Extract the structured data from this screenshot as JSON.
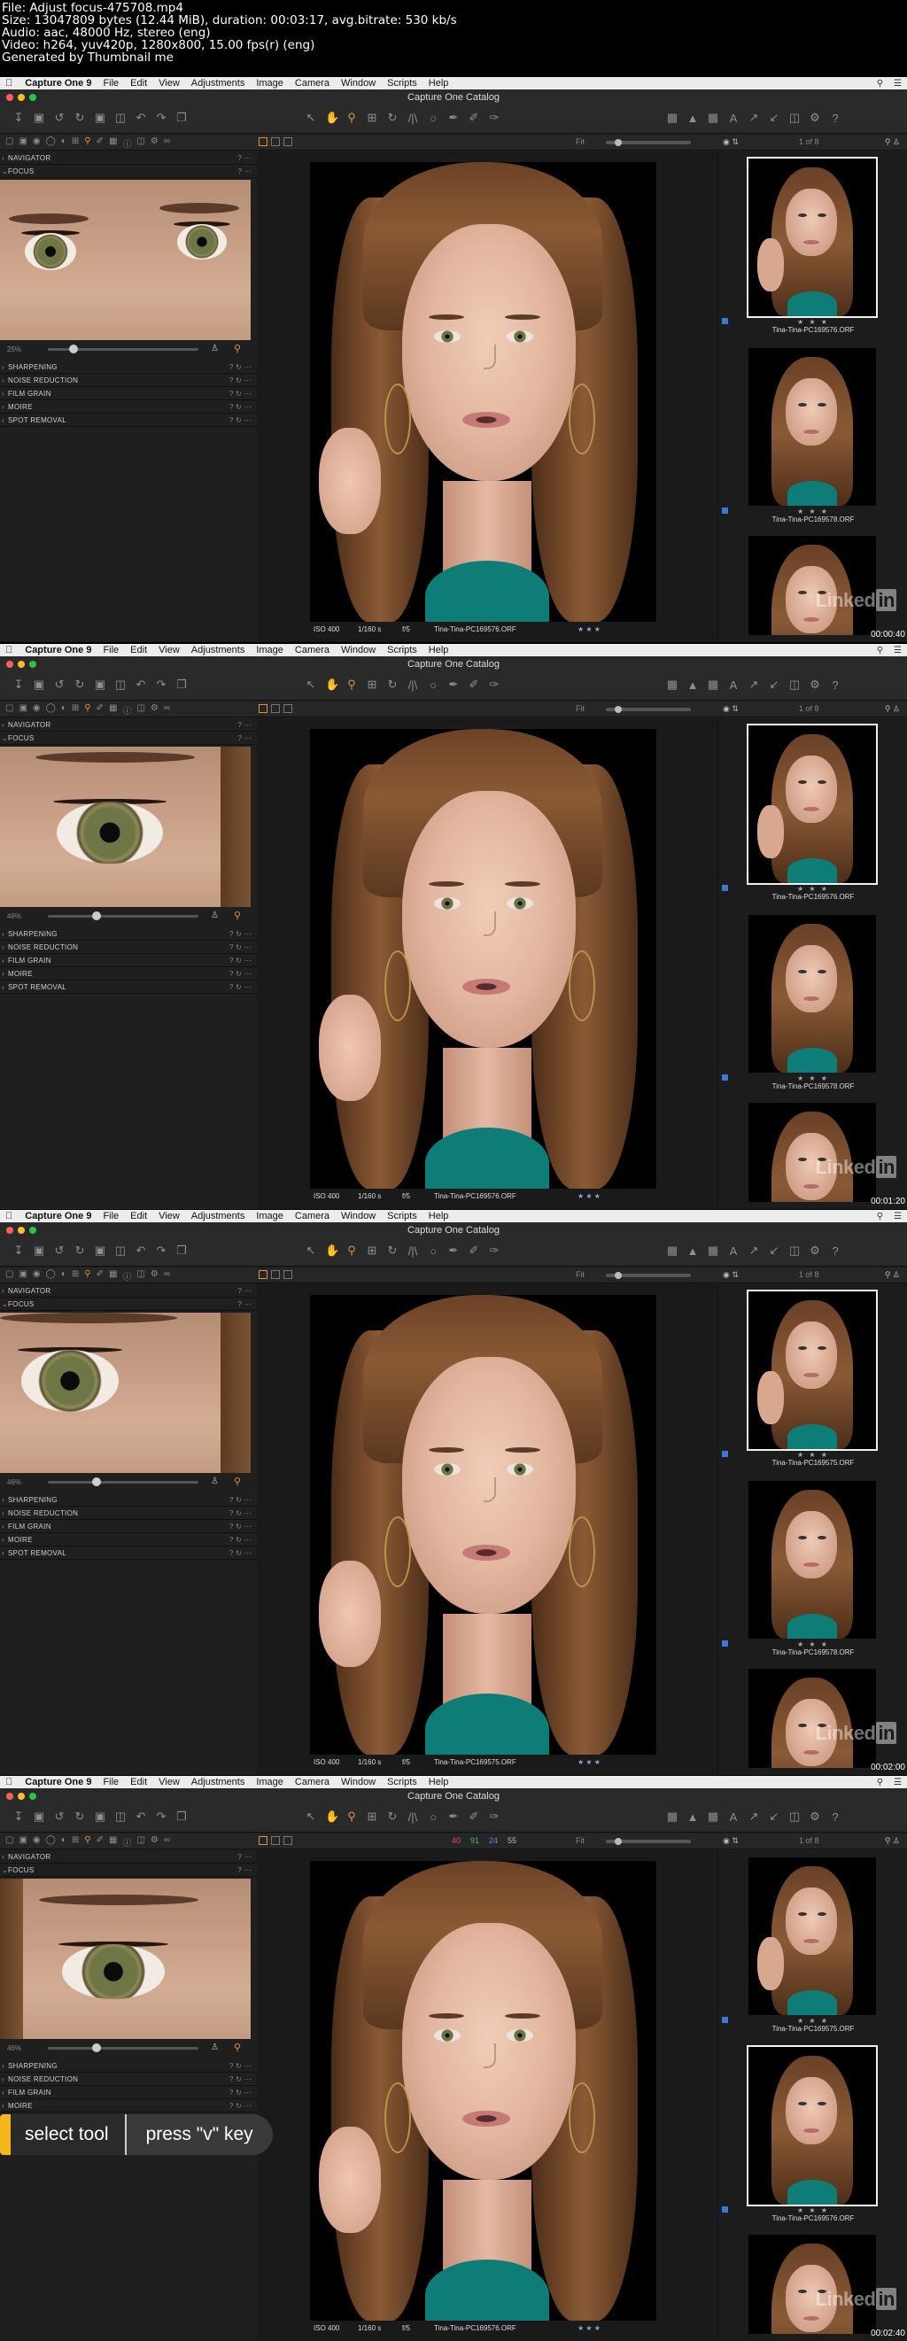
{
  "file_info": [
    "File: Adjust focus-475708.mp4",
    "Size: 13047809 bytes (12.44 MiB), duration: 00:03:17, avg.bitrate: 530 kb/s",
    "Audio: aac, 48000 Hz, stereo (eng)",
    "Video: h264, yuv420p, 1280x800, 15.00 fps(r) (eng)",
    "Generated by Thumbnail me"
  ],
  "menu": {
    "apple": "",
    "app": "Capture One 9",
    "items": [
      "File",
      "Edit",
      "View",
      "Adjustments",
      "Image",
      "Camera",
      "Window",
      "Scripts",
      "Help"
    ]
  },
  "window_title": "Capture One Catalog",
  "panels": {
    "navigator": "NAVIGATOR",
    "focus": "FOCUS",
    "sections": [
      "SHARPENING",
      "NOISE REDUCTION",
      "FILM GRAIN",
      "MOIRE",
      "SPOT REMOVAL"
    ]
  },
  "viewer": {
    "fit": "Fit",
    "iso": "ISO 400",
    "shutter": "1/160 s",
    "aperture": "f/5",
    "stars": "★ ★ ★"
  },
  "frames": [
    {
      "focus_zoom": "25%",
      "count": "1 of 8",
      "filename": "Tina-Tina-PC169576.ORF",
      "thumbs": [
        "Tina-Tina-PC169576.ORF",
        "Tina-Tina-PC169578.ORF"
      ],
      "timestamp": "00:00:40"
    },
    {
      "focus_zoom": "46%",
      "count": "1 of 8",
      "filename": "Tina-Tina-PC169576.ORF",
      "thumbs": [
        "Tina-Tina-PC169576.ORF",
        "Tina-Tina-PC169578.ORF"
      ],
      "timestamp": "00:01:20"
    },
    {
      "focus_zoom": "46%",
      "count": "1 of 8",
      "filename": "Tina-Tina-PC169575.ORF",
      "thumbs": [
        "Tina-Tina-PC169575.ORF",
        "Tina-Tina-PC169578.ORF"
      ],
      "timestamp": "00:02:00"
    },
    {
      "focus_zoom": "46%",
      "count": "1 of 8",
      "filename": "Tina-Tina-PC169576.ORF",
      "thumbs": [
        "Tina-Tina-PC169575.ORF",
        "Tina-Tina-PC169576.ORF"
      ],
      "timestamp": "00:02:40",
      "color_values": [
        {
          "value": "40",
          "color": "#e05050"
        },
        {
          "value": "91",
          "color": "#4fbf4f"
        },
        {
          "value": "24",
          "color": "#4f8fe0"
        },
        {
          "value": "55",
          "color": "#bbbbbb"
        }
      ]
    }
  ],
  "watermark": {
    "text": "Linked",
    "badge": "in"
  },
  "caption": {
    "left": "select tool",
    "right": "press \"v\" key"
  },
  "colors": {
    "accent": "#e3923d",
    "shirt": "#0e7d77",
    "caption_bar": "#f5b81c"
  }
}
